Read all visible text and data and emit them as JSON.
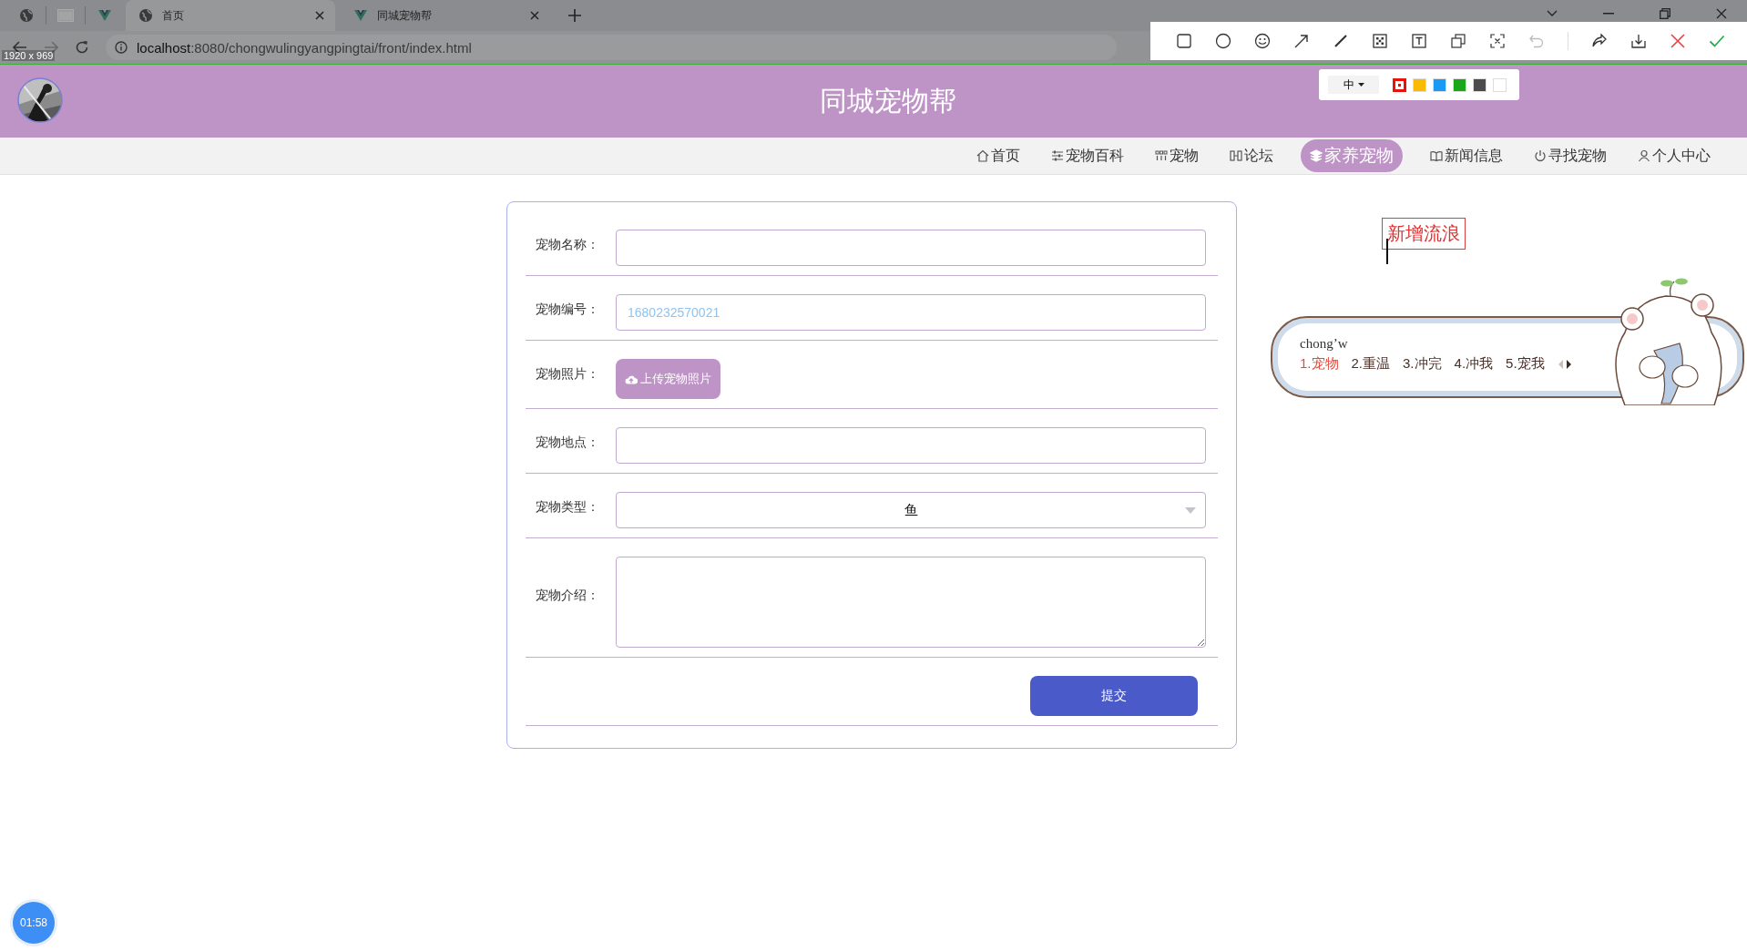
{
  "browser": {
    "tabs": [
      {
        "title": "首页",
        "selected": true
      },
      {
        "title": "同城宠物帮",
        "selected": false
      }
    ],
    "address": {
      "host": "localhost",
      "rest": ":8080/chongwulingyangpingtai/front/index.html"
    },
    "capture_size": "1920 x 969"
  },
  "capture_toolbar": {
    "font_size": "中",
    "colors": [
      {
        "color": "#e8140c",
        "selected": true
      },
      {
        "color": "#fbb900",
        "selected": false
      },
      {
        "color": "#1a9af5",
        "selected": false
      },
      {
        "color": "#1aa81a",
        "selected": false
      },
      {
        "color": "#4c4c4c",
        "selected": false
      },
      {
        "color": "#ffffff",
        "selected": false
      }
    ]
  },
  "header": {
    "title": "同城宠物帮"
  },
  "nav": [
    {
      "label": "首页",
      "selected": false
    },
    {
      "label": "宠物百科",
      "selected": false
    },
    {
      "label": "宠物",
      "selected": false
    },
    {
      "label": "论坛",
      "selected": false
    },
    {
      "label": "家养宠物",
      "selected": true
    },
    {
      "label": "新闻信息",
      "selected": false
    },
    {
      "label": "寻找宠物",
      "selected": false
    },
    {
      "label": "个人中心",
      "selected": false
    }
  ],
  "form": {
    "fields": [
      {
        "kind": "text",
        "label": "宠物名称："
      },
      {
        "kind": "readonly",
        "label": "宠物编号：",
        "value": "1680232570021"
      },
      {
        "kind": "upload",
        "label": "宠物照片：",
        "button": "上传宠物照片"
      },
      {
        "kind": "text",
        "label": "宠物地点："
      },
      {
        "kind": "select",
        "label": "宠物类型：",
        "value": "鱼"
      },
      {
        "kind": "textarea",
        "label": "宠物介绍："
      }
    ],
    "submit": "提交"
  },
  "annotation": {
    "text": "新增流浪"
  },
  "ime": {
    "input": "chong’w",
    "candidates": [
      {
        "text": "1.宠物",
        "selected": true
      },
      {
        "text": "2.重温",
        "selected": false
      },
      {
        "text": "3.冲完",
        "selected": false
      },
      {
        "text": "4.冲我",
        "selected": false
      },
      {
        "text": "5.宠我",
        "selected": false
      }
    ]
  },
  "timer": "01:58"
}
